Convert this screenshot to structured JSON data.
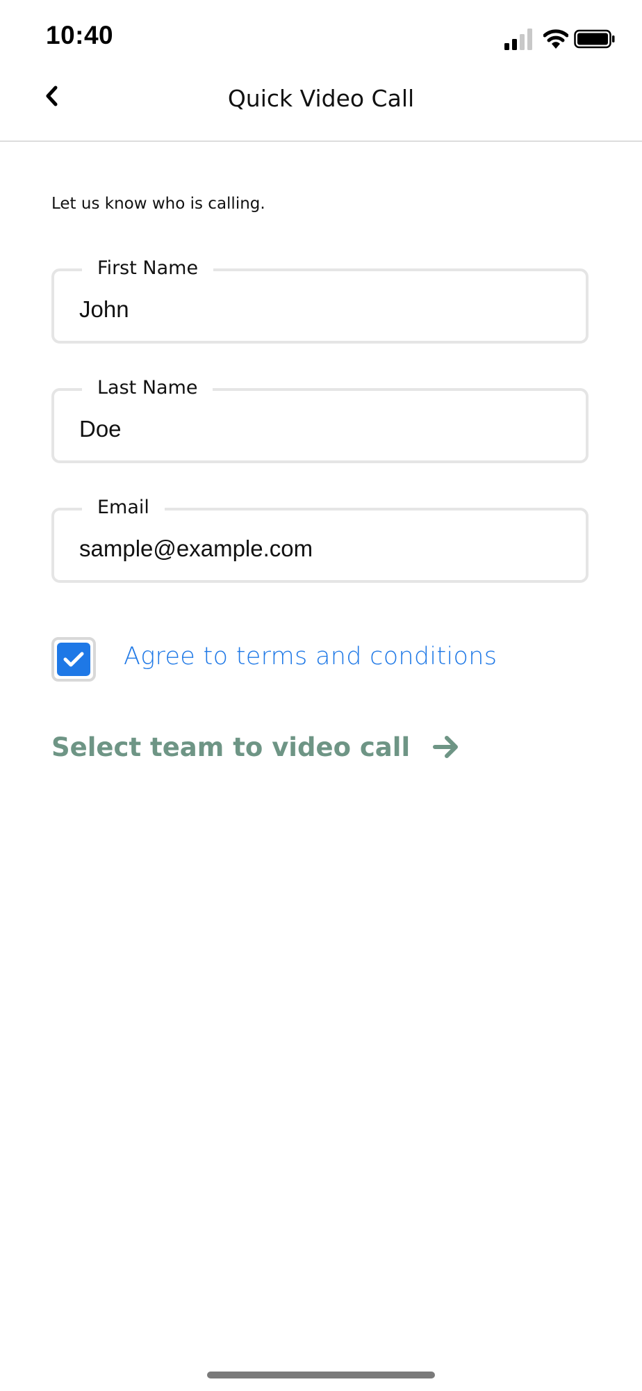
{
  "status_bar": {
    "time": "10:40"
  },
  "nav": {
    "title": "Quick Video Call",
    "back_icon": "chevron-left-icon"
  },
  "form": {
    "intro": "Let us know who is calling.",
    "first_name": {
      "label": "First Name",
      "value": "John"
    },
    "last_name": {
      "label": "Last Name",
      "value": "Doe"
    },
    "email": {
      "label": "Email",
      "value": "sample@example.com"
    },
    "agree": {
      "label": "Agree to terms and conditions",
      "checked": true
    },
    "next": {
      "label": "Select team to video call",
      "icon": "arrow-right-icon"
    }
  },
  "colors": {
    "accent_blue": "#1e78e6",
    "next_green": "#6e9585",
    "field_border": "#e5e5e5"
  }
}
